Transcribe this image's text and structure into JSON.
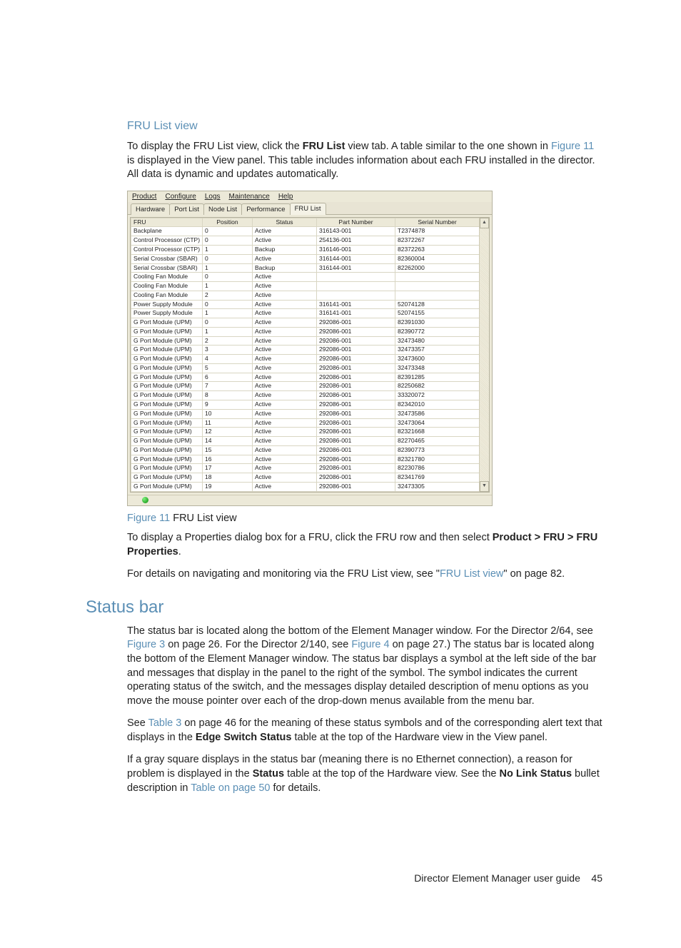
{
  "section_heading": "FRU List view",
  "p1": {
    "pre": "To display the FRU List view, click the ",
    "bold1": "FRU List",
    "mid": " view tab. A table similar to the one shown in ",
    "link": "Figure 11",
    "post": " is displayed in the View panel. This table includes information about each FRU installed in the director. All data is dynamic and updates automatically."
  },
  "screenshot": {
    "menus": [
      "Product",
      "Configure",
      "Logs",
      "Maintenance",
      "Help"
    ],
    "tabs": [
      "Hardware",
      "Port List",
      "Node List",
      "Performance",
      "FRU List"
    ],
    "active_tab": 4,
    "columns": [
      "FRU",
      "Position",
      "Status",
      "Part Number",
      "Serial Number"
    ],
    "rows": [
      {
        "fru": "Backplane",
        "pos": "0",
        "status": "Active",
        "part": "316143-001",
        "serial": "T2374878"
      },
      {
        "fru": "Control Processor (CTP)",
        "pos": "0",
        "status": "Active",
        "part": "254136-001",
        "serial": "82372267"
      },
      {
        "fru": "Control Processor (CTP)",
        "pos": "1",
        "status": "Backup",
        "part": "316146-001",
        "serial": "82372263"
      },
      {
        "fru": "Serial Crossbar (SBAR)",
        "pos": "0",
        "status": "Active",
        "part": "316144-001",
        "serial": "82360004"
      },
      {
        "fru": "Serial Crossbar (SBAR)",
        "pos": "1",
        "status": "Backup",
        "part": "316144-001",
        "serial": "82262000"
      },
      {
        "fru": "Cooling Fan Module",
        "pos": "0",
        "status": "Active",
        "part": "",
        "serial": ""
      },
      {
        "fru": "Cooling Fan Module",
        "pos": "1",
        "status": "Active",
        "part": "",
        "serial": ""
      },
      {
        "fru": "Cooling Fan Module",
        "pos": "2",
        "status": "Active",
        "part": "",
        "serial": ""
      },
      {
        "fru": "Power Supply Module",
        "pos": "0",
        "status": "Active",
        "part": "316141-001",
        "serial": "52074128"
      },
      {
        "fru": "Power Supply Module",
        "pos": "1",
        "status": "Active",
        "part": "316141-001",
        "serial": "52074155"
      },
      {
        "fru": "G Port Module (UPM)",
        "pos": "0",
        "status": "Active",
        "part": "292086-001",
        "serial": "82391030"
      },
      {
        "fru": "G Port Module (UPM)",
        "pos": "1",
        "status": "Active",
        "part": "292086-001",
        "serial": "82390772"
      },
      {
        "fru": "G Port Module (UPM)",
        "pos": "2",
        "status": "Active",
        "part": "292086-001",
        "serial": "32473480"
      },
      {
        "fru": "G Port Module (UPM)",
        "pos": "3",
        "status": "Active",
        "part": "292086-001",
        "serial": "32473357"
      },
      {
        "fru": "G Port Module (UPM)",
        "pos": "4",
        "status": "Active",
        "part": "292086-001",
        "serial": "32473600"
      },
      {
        "fru": "G Port Module (UPM)",
        "pos": "5",
        "status": "Active",
        "part": "292086-001",
        "serial": "32473348"
      },
      {
        "fru": "G Port Module (UPM)",
        "pos": "6",
        "status": "Active",
        "part": "292086-001",
        "serial": "82391285"
      },
      {
        "fru": "G Port Module (UPM)",
        "pos": "7",
        "status": "Active",
        "part": "292086-001",
        "serial": "82250682"
      },
      {
        "fru": "G Port Module (UPM)",
        "pos": "8",
        "status": "Active",
        "part": "292086-001",
        "serial": "33320072"
      },
      {
        "fru": "G Port Module (UPM)",
        "pos": "9",
        "status": "Active",
        "part": "292086-001",
        "serial": "82342010"
      },
      {
        "fru": "G Port Module (UPM)",
        "pos": "10",
        "status": "Active",
        "part": "292086-001",
        "serial": "32473586"
      },
      {
        "fru": "G Port Module (UPM)",
        "pos": "11",
        "status": "Active",
        "part": "292086-001",
        "serial": "32473064"
      },
      {
        "fru": "G Port Module (UPM)",
        "pos": "12",
        "status": "Active",
        "part": "292086-001",
        "serial": "82321668"
      },
      {
        "fru": "G Port Module (UPM)",
        "pos": "14",
        "status": "Active",
        "part": "292086-001",
        "serial": "82270465"
      },
      {
        "fru": "G Port Module (UPM)",
        "pos": "15",
        "status": "Active",
        "part": "292086-001",
        "serial": "82390773"
      },
      {
        "fru": "G Port Module (UPM)",
        "pos": "16",
        "status": "Active",
        "part": "292086-001",
        "serial": "82321780"
      },
      {
        "fru": "G Port Module (UPM)",
        "pos": "17",
        "status": "Active",
        "part": "292086-001",
        "serial": "82230786"
      },
      {
        "fru": "G Port Module (UPM)",
        "pos": "18",
        "status": "Active",
        "part": "292086-001",
        "serial": "82341769"
      },
      {
        "fru": "G Port Module (UPM)",
        "pos": "19",
        "status": "Active",
        "part": "292086-001",
        "serial": "32473305"
      }
    ]
  },
  "fig_caption": {
    "label": "Figure 11",
    "text": " FRU List view"
  },
  "p2": {
    "pre": "To display a Properties dialog box for a FRU, click the FRU row and then select ",
    "bold": "Product > FRU > FRU Properties",
    "post": "."
  },
  "p3": {
    "pre": "For details on navigating and monitoring via the FRU List view, see \"",
    "link": "FRU List view",
    "post": "\" on page 82."
  },
  "statusbar_heading": "Status bar",
  "p4": {
    "a": "The status bar is located along the bottom of the Element Manager window. For the Director 2/64, see ",
    "l1": "Figure 3",
    "b": " on page 26. For the Director 2/140, see ",
    "l2": "Figure 4",
    "c": " on page 27.) The status bar is located along the bottom of the Element Manager window. The status bar displays a symbol at the left side of the bar and messages that display in the panel to the right of the symbol. The symbol indicates the current operating status of the switch, and the messages display detailed description of menu options as you move the mouse pointer over each of the drop-down menus available from the menu bar."
  },
  "p5": {
    "a": "See ",
    "l": "Table 3",
    "b": " on page 46 for the meaning of these status symbols and of the corresponding alert text that displays in the ",
    "bold": "Edge Switch Status",
    "c": " table at the top of the Hardware view in the View panel."
  },
  "p6": {
    "a": "If a gray square displays in the status bar (meaning there is no Ethernet connection), a reason for problem is displayed in the ",
    "bold1": "Status",
    "b": " table at the top of the Hardware view. See the ",
    "bold2": "No Link Status",
    "c": " bullet description in ",
    "l": "Table  on page 50",
    "d": " for details."
  },
  "footer": {
    "title": "Director Element Manager user guide",
    "page": "45"
  }
}
